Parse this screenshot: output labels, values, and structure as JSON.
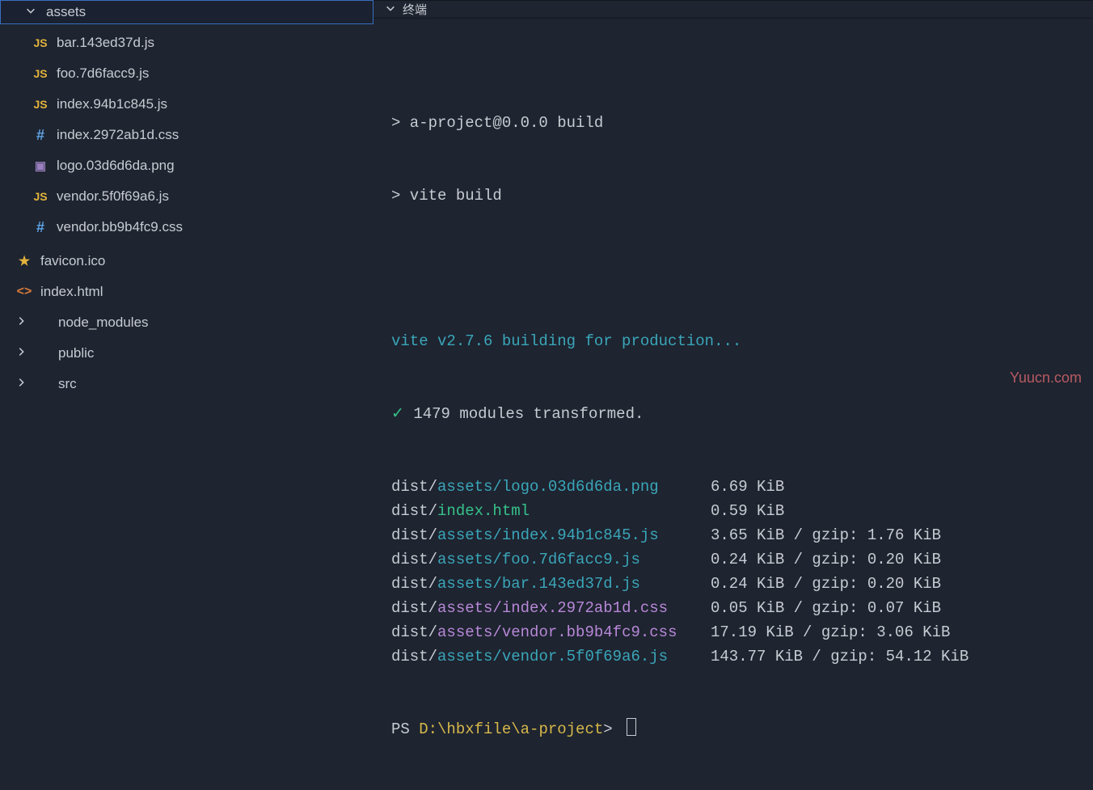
{
  "explorer": {
    "folder": "assets",
    "files": [
      {
        "name": "bar.143ed37d.js",
        "icon": "js"
      },
      {
        "name": "foo.7d6facc9.js",
        "icon": "js"
      },
      {
        "name": "index.94b1c845.js",
        "icon": "js"
      },
      {
        "name": "index.2972ab1d.css",
        "icon": "css"
      },
      {
        "name": "logo.03d6d6da.png",
        "icon": "png"
      },
      {
        "name": "vendor.5f0f69a6.js",
        "icon": "js"
      },
      {
        "name": "vendor.bb9b4fc9.css",
        "icon": "css"
      }
    ],
    "siblings": [
      {
        "name": "favicon.ico",
        "icon": "star",
        "chev": false
      },
      {
        "name": "index.html",
        "icon": "html",
        "chev": false
      },
      {
        "name": "node_modules",
        "icon": "",
        "chev": true
      },
      {
        "name": "public",
        "icon": "",
        "chev": true
      },
      {
        "name": "src",
        "icon": "",
        "chev": true
      }
    ]
  },
  "terminal": {
    "tab_label": "终端",
    "script_line": "> a-project@0.0.0 build",
    "cmd_line": "> vite build",
    "vite_msg": "vite v2.7.6 building for production...",
    "check": "✓",
    "transformed": " 1479 modules transformed.",
    "outputs": [
      {
        "prefix": "dist/",
        "dir": "assets/",
        "file": "logo.03d6d6da.png",
        "dirColor": "teal",
        "fileColor": "teal",
        "size": "6.69 KiB"
      },
      {
        "prefix": "dist/",
        "dir": "",
        "file": "index.html",
        "dirColor": "",
        "fileColor": "green",
        "size": "0.59 KiB"
      },
      {
        "prefix": "dist/",
        "dir": "assets/",
        "file": "index.94b1c845.js",
        "dirColor": "teal",
        "fileColor": "teal",
        "size": "3.65 KiB / gzip: 1.76 KiB"
      },
      {
        "prefix": "dist/",
        "dir": "assets/",
        "file": "foo.7d6facc9.js",
        "dirColor": "teal",
        "fileColor": "teal",
        "size": "0.24 KiB / gzip: 0.20 KiB"
      },
      {
        "prefix": "dist/",
        "dir": "assets/",
        "file": "bar.143ed37d.js",
        "dirColor": "teal",
        "fileColor": "teal",
        "size": "0.24 KiB / gzip: 0.20 KiB"
      },
      {
        "prefix": "dist/",
        "dir": "assets/",
        "file": "index.2972ab1d.css",
        "dirColor": "purple",
        "fileColor": "purple",
        "size": "0.05 KiB / gzip: 0.07 KiB"
      },
      {
        "prefix": "dist/",
        "dir": "assets/",
        "file": "vendor.bb9b4fc9.css",
        "dirColor": "purple",
        "fileColor": "purple",
        "size": "17.19 KiB / gzip: 3.06 KiB"
      },
      {
        "prefix": "dist/",
        "dir": "assets/",
        "file": "vendor.5f0f69a6.js",
        "dirColor": "teal",
        "fileColor": "teal",
        "size": "143.77 KiB / gzip: 54.12 KiB"
      }
    ],
    "prompt_prefix": "PS ",
    "prompt_path": "D:\\hbxfile\\a-project",
    "prompt_suffix": "> "
  },
  "watermark": "Yuucn.com"
}
